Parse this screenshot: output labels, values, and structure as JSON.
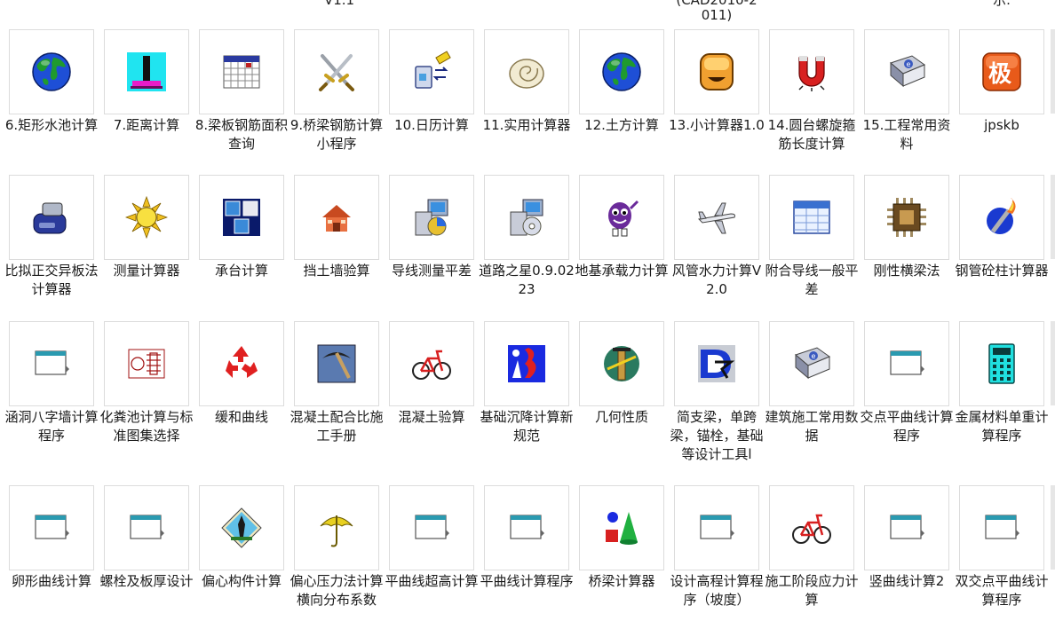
{
  "top_fragments": [
    {
      "id": "frag-v",
      "text": "V1.1"
    },
    {
      "id": "frag-cad-1",
      "text": "(CAD2010-2"
    },
    {
      "id": "frag-cad-2",
      "text": "011)"
    },
    {
      "id": "frag-right",
      "text": "示."
    }
  ],
  "items": [
    {
      "label": "6.矩形水池计算",
      "icon": "globe-icon"
    },
    {
      "label": "7.距离计算",
      "icon": "ruler-gauge-icon"
    },
    {
      "label": "8.梁板钢筋面积查询",
      "icon": "calendar-grid-icon"
    },
    {
      "label": "9.桥梁钢筋计算小程序",
      "icon": "crossed-swords-icon"
    },
    {
      "label": "10.日历计算",
      "icon": "transfer-arrows-icon"
    },
    {
      "label": "11.实用计算器",
      "icon": "shell-icon"
    },
    {
      "label": "12.土方计算",
      "icon": "globe-icon"
    },
    {
      "label": "13.小计算器1.0",
      "icon": "orange-box-icon"
    },
    {
      "label": "14.圆台螺旋箍筋长度计算",
      "icon": "magnet-icon"
    },
    {
      "label": "15.工程常用资料",
      "icon": "book-icon"
    },
    {
      "label": "jpskb",
      "icon": "ji-badge-icon"
    },
    {
      "label": "比拟正交异板法计算器",
      "icon": "stapler-icon"
    },
    {
      "label": "测量计算器",
      "icon": "sun-icon"
    },
    {
      "label": "承台计算",
      "icon": "cubes-icon"
    },
    {
      "label": "挡土墙验算",
      "icon": "house-icon"
    },
    {
      "label": "导线测量平差",
      "icon": "installer-icon"
    },
    {
      "label": "道路之星0.9.0223",
      "icon": "installer-disc-icon"
    },
    {
      "label": "地基承载力计算",
      "icon": "grape-mascot-icon"
    },
    {
      "label": "风管水力计算V2.0",
      "icon": "airplane-icon"
    },
    {
      "label": "附合导线一般平差",
      "icon": "spreadsheet-icon"
    },
    {
      "label": "刚性横梁法",
      "icon": "chip-icon"
    },
    {
      "label": "钢管砼柱计算器",
      "icon": "torch-icon"
    },
    {
      "label": "涵洞八字墙计算程序",
      "icon": "app-window-icon"
    },
    {
      "label": "化粪池计算与标准图集选择",
      "icon": "cad-drawing-icon"
    },
    {
      "label": "缓和曲线",
      "icon": "recycle-icon"
    },
    {
      "label": "混凝土配合比施工手册",
      "icon": "pickaxe-icon"
    },
    {
      "label": "混凝土验算",
      "icon": "bicycle-icon"
    },
    {
      "label": "基础沉降计算新规范",
      "icon": "blue-red-figure-icon"
    },
    {
      "label": "几何性质",
      "icon": "column-icon"
    },
    {
      "label": "简支梁，单跨梁，锚栓，基础等设计工具l",
      "icon": "d-logo-icon"
    },
    {
      "label": "建筑施工常用数据",
      "icon": "book-icon"
    },
    {
      "label": "交点平曲线计算程序",
      "icon": "app-window-icon"
    },
    {
      "label": "金属材料单重计算程序",
      "icon": "calculator-icon"
    },
    {
      "label": "卵形曲线计算",
      "icon": "app-window-icon"
    },
    {
      "label": "螺栓及板厚设计",
      "icon": "app-window-icon"
    },
    {
      "label": "偏心构件计算",
      "icon": "diamond-figure-icon"
    },
    {
      "label": "偏心压力法计算横向分布系数",
      "icon": "umbrella-icon"
    },
    {
      "label": "平曲线超高计算",
      "icon": "app-window-icon"
    },
    {
      "label": "平曲线计算程序",
      "icon": "app-window-icon"
    },
    {
      "label": "桥梁计算器",
      "icon": "shapes-icon"
    },
    {
      "label": "设计高程计算程序（坡度）",
      "icon": "app-window-icon"
    },
    {
      "label": "施工阶段应力计算",
      "icon": "bicycle-icon"
    },
    {
      "label": "竖曲线计算2",
      "icon": "app-window-icon"
    },
    {
      "label": "双交点平曲线计算程序",
      "icon": "app-window-icon"
    }
  ]
}
